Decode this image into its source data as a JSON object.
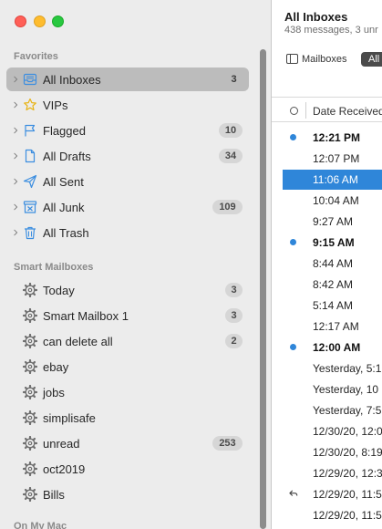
{
  "sidebar": {
    "favorites_header": "Favorites",
    "favorites": [
      {
        "label": "All Inboxes",
        "count": "3",
        "icon": "inbox-tray-icon",
        "selected": true
      },
      {
        "label": "VIPs",
        "count": "",
        "icon": "star-icon"
      },
      {
        "label": "Flagged",
        "count": "10",
        "icon": "flag-icon"
      },
      {
        "label": "All Drafts",
        "count": "34",
        "icon": "document-icon"
      },
      {
        "label": "All Sent",
        "count": "",
        "icon": "paper-plane-icon"
      },
      {
        "label": "All Junk",
        "count": "109",
        "icon": "junk-box-icon"
      },
      {
        "label": "All Trash",
        "count": "",
        "icon": "trash-icon"
      }
    ],
    "smart_header": "Smart Mailboxes",
    "smart": [
      {
        "label": "Today",
        "count": "3"
      },
      {
        "label": "Smart Mailbox 1",
        "count": "3"
      },
      {
        "label": "can delete all",
        "count": "2"
      },
      {
        "label": "ebay",
        "count": ""
      },
      {
        "label": "jobs",
        "count": ""
      },
      {
        "label": "simplisafe",
        "count": ""
      },
      {
        "label": "unread",
        "count": "253"
      },
      {
        "label": "oct2019",
        "count": ""
      },
      {
        "label": "Bills",
        "count": ""
      }
    ],
    "on_my_mac_header": "On My Mac"
  },
  "main": {
    "title": "All Inboxes",
    "subtitle": "438 messages, 3 unr",
    "mailboxes_button": "Mailboxes",
    "all_button": "All",
    "column_header": "Date Received",
    "messages": [
      {
        "time": "12:21 PM",
        "unread": true
      },
      {
        "time": "12:07 PM"
      },
      {
        "time": "11:06 AM",
        "selected": true
      },
      {
        "time": "10:04 AM"
      },
      {
        "time": "9:27 AM"
      },
      {
        "time": "9:15 AM",
        "unread": true
      },
      {
        "time": "8:44 AM"
      },
      {
        "time": "8:42 AM"
      },
      {
        "time": "5:14 AM"
      },
      {
        "time": "12:17 AM"
      },
      {
        "time": "12:00 AM",
        "unread": true
      },
      {
        "time": "Yesterday, 5:1"
      },
      {
        "time": "Yesterday, 10"
      },
      {
        "time": "Yesterday, 7:5"
      },
      {
        "time": "12/30/20, 12:0"
      },
      {
        "time": "12/30/20, 8:19"
      },
      {
        "time": "12/29/20, 12:3"
      },
      {
        "time": "12/29/20, 11:5",
        "replied": true
      },
      {
        "time": "12/29/20, 11:5"
      }
    ]
  },
  "colors": {
    "sidebar_bg": "#ececec",
    "selection_gray": "#bcbcbc",
    "accent_blue": "#2f86d9",
    "close": "#ff5f57",
    "minimize": "#febc2e",
    "zoom": "#28c840"
  }
}
